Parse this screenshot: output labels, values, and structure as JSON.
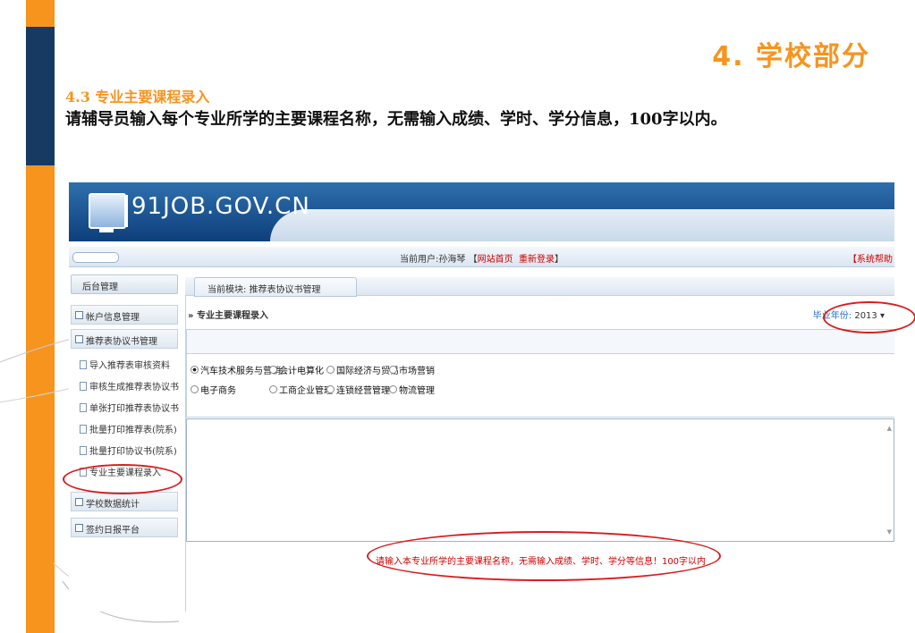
{
  "slide": {
    "title": "4. 学校部分",
    "subtitle": "4.3 专业主要课程录入",
    "body": "请辅导员输入每个专业所学的主要课程名称，无需输入成绩、学时、学分信息，100字以内。"
  },
  "app": {
    "logo": "91JOB.GOV.CN",
    "topbar": {
      "user_prefix": "当前用户:孙海琴 【",
      "home_link": "网站首页",
      "relogin_link": "重新登录",
      "user_suffix": "】",
      "logout": "【系统帮助"
    },
    "sidebar": {
      "header": "后台管理",
      "groups": [
        {
          "label": "帐户信息管理"
        },
        {
          "label": "推荐表协议书管理"
        },
        {
          "label": "学校数据统计"
        },
        {
          "label": "签约日报平台"
        }
      ],
      "items": [
        {
          "label": "导入推荐表审核资料"
        },
        {
          "label": "审核生成推荐表协议书"
        },
        {
          "label": "单张打印推荐表协议书"
        },
        {
          "label": "批量打印推荐表(院系)"
        },
        {
          "label": "批量打印协议书(院系)"
        },
        {
          "label": "专业主要课程录入"
        }
      ]
    },
    "breadcrumb": "当前模块: 推荐表协议书管理",
    "content": {
      "title": "专业主要课程录入",
      "year_label": "毕业年份:",
      "year_value": "2013",
      "majors": [
        {
          "label": "汽车技术服务与营销",
          "checked": true
        },
        {
          "label": "会计电算化",
          "checked": false
        },
        {
          "label": "国际经济与贸易",
          "checked": false
        },
        {
          "label": "市场营销",
          "checked": false
        },
        {
          "label": "电子商务",
          "checked": false
        },
        {
          "label": "工商企业管理",
          "checked": false
        },
        {
          "label": "连锁经营管理",
          "checked": false
        },
        {
          "label": "物流管理",
          "checked": false
        }
      ],
      "hint": "请输入本专业所学的主要课程名称，无需输入成绩、学时、学分等信息！100字以内"
    }
  },
  "colors": {
    "accent": "#f7941d",
    "navy": "#173a63",
    "annotation": "#d81e1e"
  }
}
